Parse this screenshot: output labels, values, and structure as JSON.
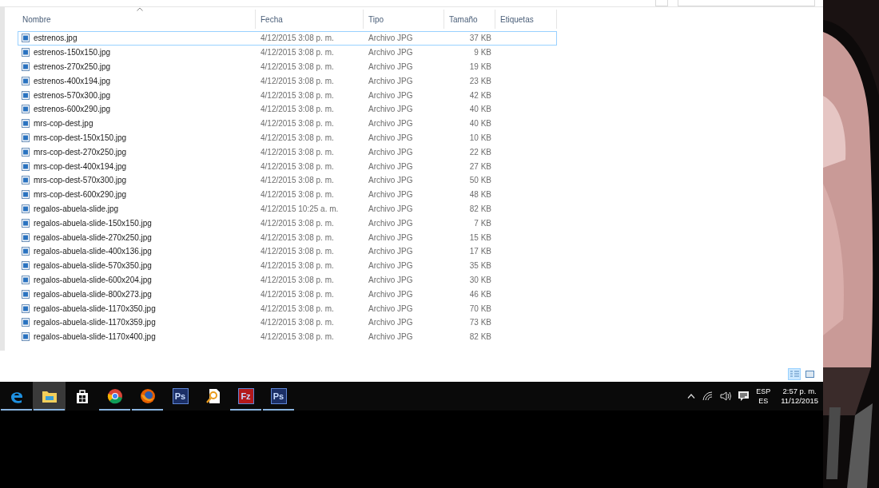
{
  "columns": [
    {
      "label": "Nombre",
      "sorted": true
    },
    {
      "label": "Fecha",
      "sorted": false
    },
    {
      "label": "Tipo",
      "sorted": false
    },
    {
      "label": "Tamaño",
      "sorted": false
    },
    {
      "label": "Etiquetas",
      "sorted": false
    }
  ],
  "files": [
    {
      "name": "estrenos.jpg",
      "date": "4/12/2015 3:08 p. m.",
      "type": "Archivo JPG",
      "size": "37 KB",
      "focused": true
    },
    {
      "name": "estrenos-150x150.jpg",
      "date": "4/12/2015 3:08 p. m.",
      "type": "Archivo JPG",
      "size": "9 KB",
      "focused": false
    },
    {
      "name": "estrenos-270x250.jpg",
      "date": "4/12/2015 3:08 p. m.",
      "type": "Archivo JPG",
      "size": "19 KB",
      "focused": false
    },
    {
      "name": "estrenos-400x194.jpg",
      "date": "4/12/2015 3:08 p. m.",
      "type": "Archivo JPG",
      "size": "23 KB",
      "focused": false
    },
    {
      "name": "estrenos-570x300.jpg",
      "date": "4/12/2015 3:08 p. m.",
      "type": "Archivo JPG",
      "size": "42 KB",
      "focused": false
    },
    {
      "name": "estrenos-600x290.jpg",
      "date": "4/12/2015 3:08 p. m.",
      "type": "Archivo JPG",
      "size": "40 KB",
      "focused": false
    },
    {
      "name": "mrs-cop-dest.jpg",
      "date": "4/12/2015 3:08 p. m.",
      "type": "Archivo JPG",
      "size": "40 KB",
      "focused": false
    },
    {
      "name": "mrs-cop-dest-150x150.jpg",
      "date": "4/12/2015 3:08 p. m.",
      "type": "Archivo JPG",
      "size": "10 KB",
      "focused": false
    },
    {
      "name": "mrs-cop-dest-270x250.jpg",
      "date": "4/12/2015 3:08 p. m.",
      "type": "Archivo JPG",
      "size": "22 KB",
      "focused": false
    },
    {
      "name": "mrs-cop-dest-400x194.jpg",
      "date": "4/12/2015 3:08 p. m.",
      "type": "Archivo JPG",
      "size": "27 KB",
      "focused": false
    },
    {
      "name": "mrs-cop-dest-570x300.jpg",
      "date": "4/12/2015 3:08 p. m.",
      "type": "Archivo JPG",
      "size": "50 KB",
      "focused": false
    },
    {
      "name": "mrs-cop-dest-600x290.jpg",
      "date": "4/12/2015 3:08 p. m.",
      "type": "Archivo JPG",
      "size": "48 KB",
      "focused": false
    },
    {
      "name": "regalos-abuela-slide.jpg",
      "date": "4/12/2015 10:25 a. m.",
      "type": "Archivo JPG",
      "size": "82 KB",
      "focused": false
    },
    {
      "name": "regalos-abuela-slide-150x150.jpg",
      "date": "4/12/2015 3:08 p. m.",
      "type": "Archivo JPG",
      "size": "7 KB",
      "focused": false
    },
    {
      "name": "regalos-abuela-slide-270x250.jpg",
      "date": "4/12/2015 3:08 p. m.",
      "type": "Archivo JPG",
      "size": "15 KB",
      "focused": false
    },
    {
      "name": "regalos-abuela-slide-400x136.jpg",
      "date": "4/12/2015 3:08 p. m.",
      "type": "Archivo JPG",
      "size": "17 KB",
      "focused": false
    },
    {
      "name": "regalos-abuela-slide-570x350.jpg",
      "date": "4/12/2015 3:08 p. m.",
      "type": "Archivo JPG",
      "size": "35 KB",
      "focused": false
    },
    {
      "name": "regalos-abuela-slide-600x204.jpg",
      "date": "4/12/2015 3:08 p. m.",
      "type": "Archivo JPG",
      "size": "30 KB",
      "focused": false
    },
    {
      "name": "regalos-abuela-slide-800x273.jpg",
      "date": "4/12/2015 3:08 p. m.",
      "type": "Archivo JPG",
      "size": "46 KB",
      "focused": false
    },
    {
      "name": "regalos-abuela-slide-1170x350.jpg",
      "date": "4/12/2015 3:08 p. m.",
      "type": "Archivo JPG",
      "size": "70 KB",
      "focused": false
    },
    {
      "name": "regalos-abuela-slide-1170x359.jpg",
      "date": "4/12/2015 3:08 p. m.",
      "type": "Archivo JPG",
      "size": "73 KB",
      "focused": false
    },
    {
      "name": "regalos-abuela-slide-1170x400.jpg",
      "date": "4/12/2015 3:08 p. m.",
      "type": "Archivo JPG",
      "size": "82 KB",
      "focused": false
    }
  ],
  "view_buttons": [
    {
      "kind": "details",
      "selected": true
    },
    {
      "kind": "thumbnails",
      "selected": false
    }
  ],
  "taskbar": [
    {
      "kind": "edge",
      "running": true,
      "active": false
    },
    {
      "kind": "folder",
      "running": true,
      "active": true
    },
    {
      "kind": "store",
      "running": false,
      "active": false
    },
    {
      "kind": "chrome",
      "running": true,
      "active": false
    },
    {
      "kind": "firefox",
      "running": true,
      "active": false
    },
    {
      "kind": "tile",
      "label": "Ps",
      "color": "#1b2f66",
      "running": false,
      "active": false
    },
    {
      "kind": "document",
      "running": false,
      "active": false
    },
    {
      "kind": "tile",
      "label": "Fz",
      "color": "#b3191b",
      "running": true,
      "active": false
    },
    {
      "kind": "tile",
      "label": "Ps",
      "color": "#1b2f66",
      "running": true,
      "active": false
    }
  ],
  "tray": {
    "language": "ESP",
    "layout": "ES",
    "time": "2:57 p. m.",
    "date": "11/12/2015"
  }
}
